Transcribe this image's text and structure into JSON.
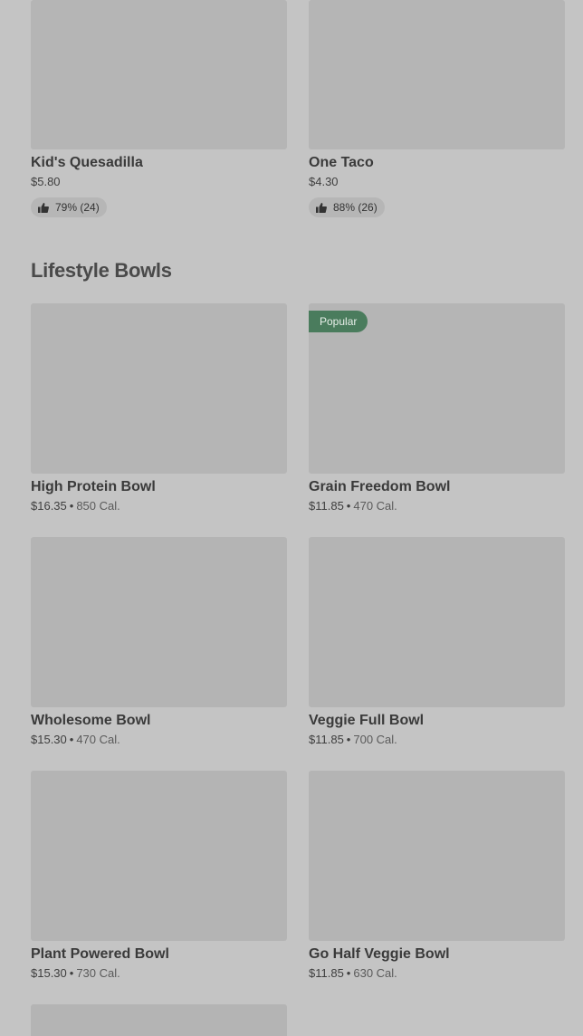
{
  "top_items": [
    {
      "name": "Kid's Quesadilla",
      "price": "$5.80",
      "rating": "79% (24)"
    },
    {
      "name": "One Taco",
      "price": "$4.30",
      "rating": "88% (26)"
    }
  ],
  "section": {
    "title": "Lifestyle Bowls"
  },
  "bowls": [
    {
      "name": "High Protein Bowl",
      "price": "$16.35",
      "separator": "•",
      "calories": "850 Cal."
    },
    {
      "name": "Grain Freedom Bowl",
      "price": "$11.85",
      "separator": "•",
      "calories": "470 Cal.",
      "badge": "Popular"
    },
    {
      "name": "Wholesome Bowl",
      "price": "$15.30",
      "separator": "•",
      "calories": "470 Cal."
    },
    {
      "name": "Veggie Full Bowl",
      "price": "$11.85",
      "separator": "•",
      "calories": "700 Cal."
    },
    {
      "name": "Plant Powered Bowl",
      "price": "$15.30",
      "separator": "•",
      "calories": "730 Cal."
    },
    {
      "name": "Go Half Veggie Bowl",
      "price": "$11.85",
      "separator": "•",
      "calories": "630 Cal."
    }
  ],
  "colors": {
    "background": "#c4c4c4",
    "badge": "#4a7c5d"
  },
  "icons": {
    "rating": "thumbs-up-icon"
  }
}
